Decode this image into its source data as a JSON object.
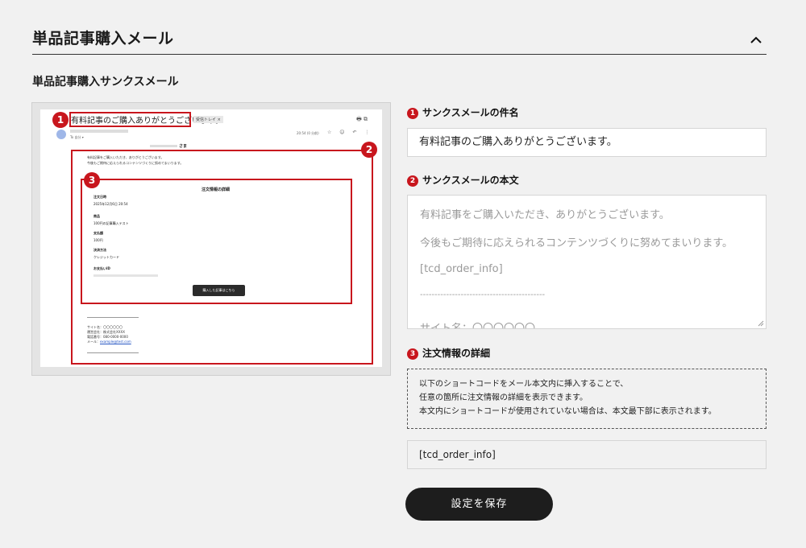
{
  "section": {
    "title": "単品記事購入メール"
  },
  "subsection": {
    "title": "単品記事購入サンクスメール"
  },
  "preview": {
    "subject": "有料記事のご購入ありがとうございます。",
    "tag": "受信トレイ ×",
    "to": "To 自分 ▾",
    "time": "20:54 (0 分前)",
    "header_icons": "🖶 ⧉",
    "row_icons": "☆ ☺ ↶ ⋮",
    "sama": "さま",
    "body_line1": "有料記事をご購入いただき、ありがとうございます。",
    "body_line2": "今後もご期待に応えられるコンテンツづくりに努めてまいります。",
    "order_title": "注文情報の詳細",
    "order_fields": [
      {
        "label": "注文日時",
        "value": "2025年12月6日 20:54"
      },
      {
        "label": "商品",
        "value": "100円の記事購入テスト"
      },
      {
        "label": "支払額",
        "value": "100円"
      },
      {
        "label": "決済方法",
        "value": "クレジットカード"
      },
      {
        "label": "お支払いID",
        "value": ""
      }
    ],
    "order_button": "購入した記事はこちら",
    "footer": {
      "site": "サイト名：〇〇〇〇〇〇",
      "company": "運営会社：株式会社XXXX",
      "phone": "電話番号：080-0000-0000",
      "mail_label": "メール：",
      "mail": "example@test.com"
    },
    "badges": [
      "1",
      "2",
      "3"
    ]
  },
  "fields": {
    "subject": {
      "number": "1",
      "label": "サンクスメールの件名",
      "value": "有料記事のご購入ありがとうございます。"
    },
    "body": {
      "number": "2",
      "label": "サンクスメールの本文",
      "lines": [
        "有料記事をご購入いただき、ありがとうございます。",
        "今後もご期待に応えられるコンテンツづくりに努めてまいります。",
        "[tcd_order_info]",
        "-------------------------------------------",
        "サイト名：〇〇〇〇〇〇"
      ]
    },
    "order_info": {
      "number": "3",
      "label": "注文情報の詳細",
      "note_lines": [
        "以下のショートコードをメール本文内に挿入することで、",
        "任意の箇所に注文情報の詳細を表示できます。",
        "本文内にショートコードが使用されていない場合は、本文最下部に表示されます。"
      ],
      "shortcode": "[tcd_order_info]"
    }
  },
  "save_button": "設定を保存",
  "colors": {
    "accent_red": "#c8161d",
    "button_dark": "#1d1d1d",
    "background": "#f1f1f1"
  }
}
